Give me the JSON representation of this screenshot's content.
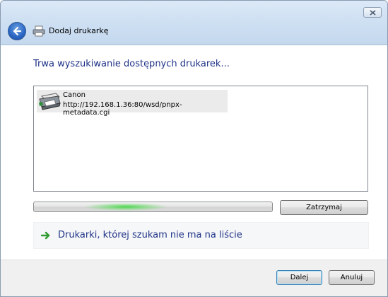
{
  "window": {
    "title": "Dodaj drukarkę",
    "close_icon": "close-icon",
    "back_icon": "back-arrow-icon",
    "title_icon": "printer-icon"
  },
  "main": {
    "heading": "Trwa wyszukiwanie dostępnych drukarek...",
    "printers": [
      {
        "name": "Canon",
        "url": "http://192.168.1.36:80/wsd/pnpx-metadata.cgi",
        "icon": "printer-icon"
      }
    ],
    "progress_state": "indeterminate",
    "stop_label": "Zatrzymaj",
    "not_listed_link": "Drukarki, której szukam nie ma na liście",
    "link_icon": "green-arrow-icon"
  },
  "footer": {
    "next_label": "Dalej",
    "cancel_label": "Anuluj"
  },
  "colors": {
    "heading": "#1e3287",
    "titlebar": "#cfe0f3",
    "progress_glow": "#4dd64d"
  }
}
